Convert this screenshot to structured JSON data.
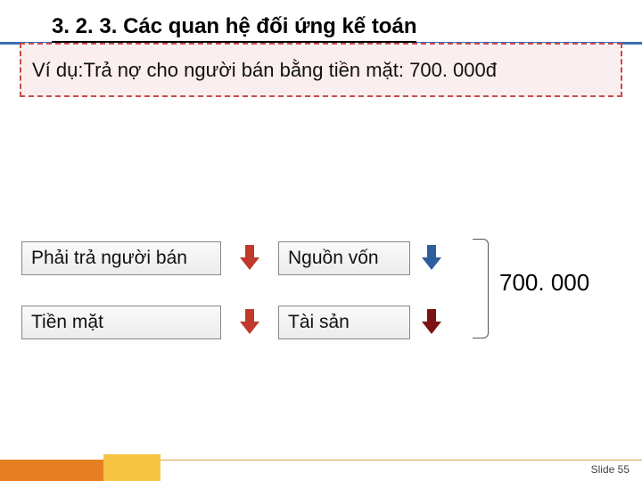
{
  "header": {
    "section_number": "3. 2. 3.",
    "section_title": "Các quan hệ đối ứng kế toán"
  },
  "example": {
    "label": "Ví dụ:",
    "text": "Trả nợ cho người bán bằng tiền mặt: 700. 000đ"
  },
  "rows": [
    {
      "left": "Phải trả người bán",
      "mid": "Nguồn vốn"
    },
    {
      "left": "Tiền mặt",
      "mid": "Tài sản"
    }
  ],
  "amount": "700. 000",
  "footer": {
    "slide_label": "Slide",
    "slide_number": "55"
  }
}
